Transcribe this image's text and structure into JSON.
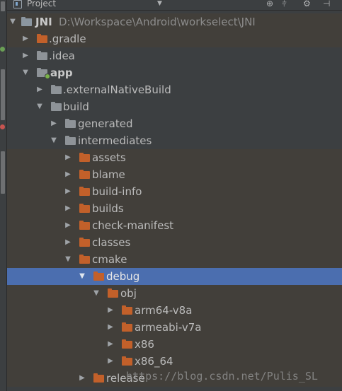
{
  "toolbar": {
    "title": "Project",
    "dropdown_icon": "caret-down-icon",
    "icons": [
      "target-icon",
      "collapse-all-icon",
      "gear-icon",
      "pin-icon"
    ]
  },
  "tree": {
    "root": {
      "name": "JNI",
      "path": "D:\\Workspace\\Android\\workselect\\JNI"
    },
    "items": [
      {
        "label": ".gradle",
        "icon": "folder-icon",
        "expanded": false
      },
      {
        "label": ".idea",
        "icon": "folder-icon",
        "expanded": false
      },
      {
        "label": "app",
        "icon": "module-folder-icon",
        "expanded": true
      },
      {
        "label": ".externalNativeBuild",
        "icon": "folder-icon",
        "expanded": false
      },
      {
        "label": "build",
        "icon": "folder-icon",
        "expanded": true
      },
      {
        "label": "generated",
        "icon": "folder-icon",
        "expanded": false
      },
      {
        "label": "intermediates",
        "icon": "folder-icon",
        "expanded": true
      },
      {
        "label": "assets",
        "icon": "folder-icon",
        "expanded": false
      },
      {
        "label": "blame",
        "icon": "folder-icon",
        "expanded": false
      },
      {
        "label": "build-info",
        "icon": "folder-icon",
        "expanded": false
      },
      {
        "label": "builds",
        "icon": "folder-icon",
        "expanded": false
      },
      {
        "label": "check-manifest",
        "icon": "folder-icon",
        "expanded": false
      },
      {
        "label": "classes",
        "icon": "folder-icon",
        "expanded": false
      },
      {
        "label": "cmake",
        "icon": "folder-icon",
        "expanded": true
      },
      {
        "label": "debug",
        "icon": "folder-icon",
        "expanded": true,
        "selected": true
      },
      {
        "label": "obj",
        "icon": "folder-icon",
        "expanded": true
      },
      {
        "label": "arm64-v8a",
        "icon": "folder-icon",
        "expanded": false
      },
      {
        "label": "armeabi-v7a",
        "icon": "folder-icon",
        "expanded": false
      },
      {
        "label": "x86",
        "icon": "folder-icon",
        "expanded": false
      },
      {
        "label": "x86_64",
        "icon": "folder-icon",
        "expanded": false
      },
      {
        "label": "release",
        "icon": "folder-icon",
        "expanded": false
      }
    ]
  },
  "watermark": "https://blog.csdn.net/Pulis_SL",
  "colors": {
    "background": "#3c3f41",
    "selection": "#4b6eaf",
    "folder": "#c2602a",
    "text": "#bbbbbb"
  }
}
